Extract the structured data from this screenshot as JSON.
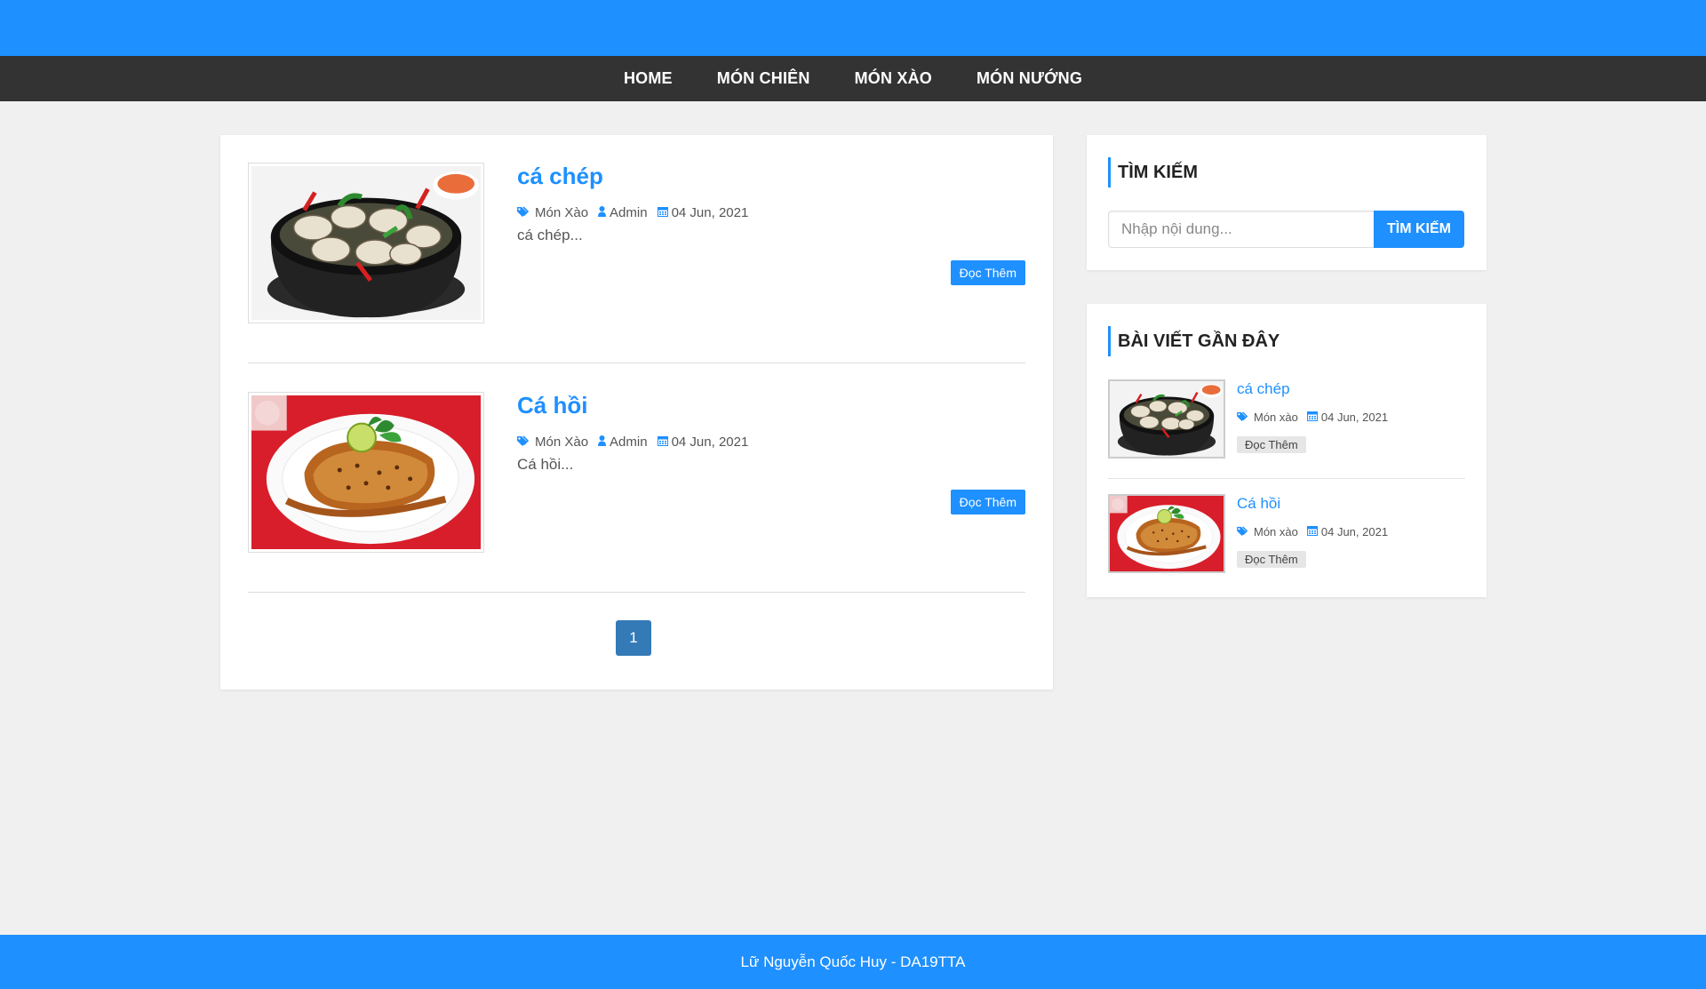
{
  "colors": {
    "accent": "#1e90ff",
    "nav_bg": "#333333",
    "page_bg": "#f0f0f0",
    "pager": "#337ab7"
  },
  "nav": {
    "items": [
      {
        "label": "HOME"
      },
      {
        "label": "MÓN CHIÊN"
      },
      {
        "label": "MÓN XÀO"
      },
      {
        "label": "MÓN NƯỚNG"
      }
    ]
  },
  "posts": [
    {
      "title": "cá chép",
      "category": "Món Xào",
      "author": "Admin",
      "date": "04 Jun, 2021",
      "excerpt": "cá chép...",
      "read_more": "Đọc Thêm",
      "image_icon": "clam-pot-dish"
    },
    {
      "title": "Cá hồi",
      "category": "Món Xào",
      "author": "Admin",
      "date": "04 Jun, 2021",
      "excerpt": "Cá hồi...",
      "read_more": "Đọc Thêm",
      "image_icon": "salmon-plate-dish"
    }
  ],
  "pagination": {
    "current": "1"
  },
  "sidebar": {
    "search": {
      "title": "TÌM KIẾM",
      "placeholder": "Nhập nội dung...",
      "button": "TÌM KIẾM"
    },
    "recent": {
      "title": "BÀI VIẾT GẦN ĐÂY",
      "items": [
        {
          "title": "cá chép",
          "category": "Món xào",
          "date": "04 Jun, 2021",
          "read_more": "Đọc Thêm"
        },
        {
          "title": "Cá hồi",
          "category": "Món xào",
          "date": "04 Jun, 2021",
          "read_more": "Đọc Thêm"
        }
      ]
    }
  },
  "icons": {
    "tag": "tags-icon",
    "author": "user-icon",
    "date": "calendar-icon"
  },
  "footer": {
    "text": "Lữ Nguyễn Quốc Huy - DA19TTA"
  }
}
